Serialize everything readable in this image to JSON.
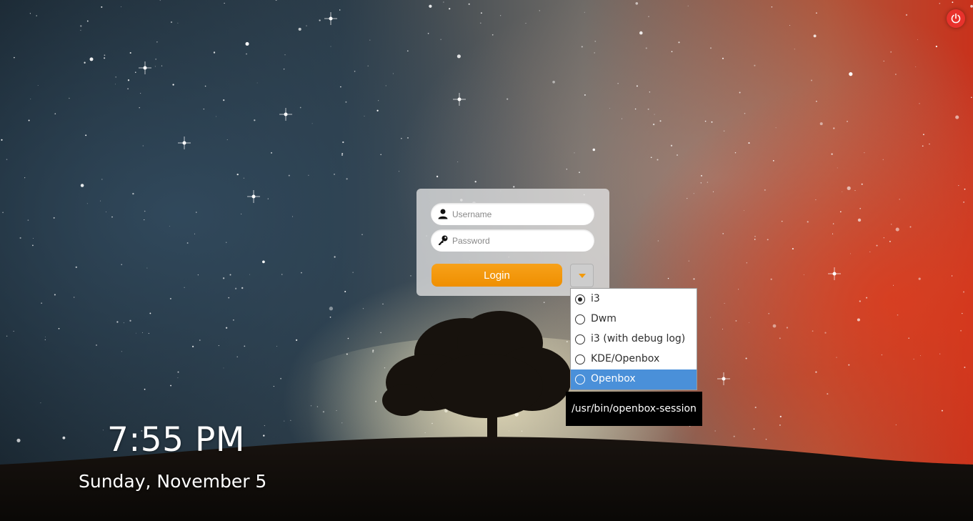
{
  "power": {
    "icon": "power-icon",
    "color": "#e8322c"
  },
  "login": {
    "username_placeholder": "Username",
    "username_value": "",
    "password_placeholder": "Password",
    "password_value": "",
    "login_label": "Login",
    "accent": "#f39a0a",
    "user_icon": "user-icon",
    "key_icon": "key-icon",
    "toggle_icon": "caret-down-icon"
  },
  "session_menu": {
    "items": [
      {
        "label": "i3",
        "checked": true,
        "highlighted": false
      },
      {
        "label": "Dwm",
        "checked": false,
        "highlighted": false
      },
      {
        "label": "i3 (with debug log)",
        "checked": false,
        "highlighted": false
      },
      {
        "label": "KDE/Openbox",
        "checked": false,
        "highlighted": false
      },
      {
        "label": "Openbox",
        "checked": false,
        "highlighted": true
      }
    ],
    "highlight_color": "#4a90d9"
  },
  "tooltip": {
    "text": "/usr/bin/openbox-session"
  },
  "clock": {
    "time": "7:55 PM",
    "date": "Sunday, November 5"
  }
}
